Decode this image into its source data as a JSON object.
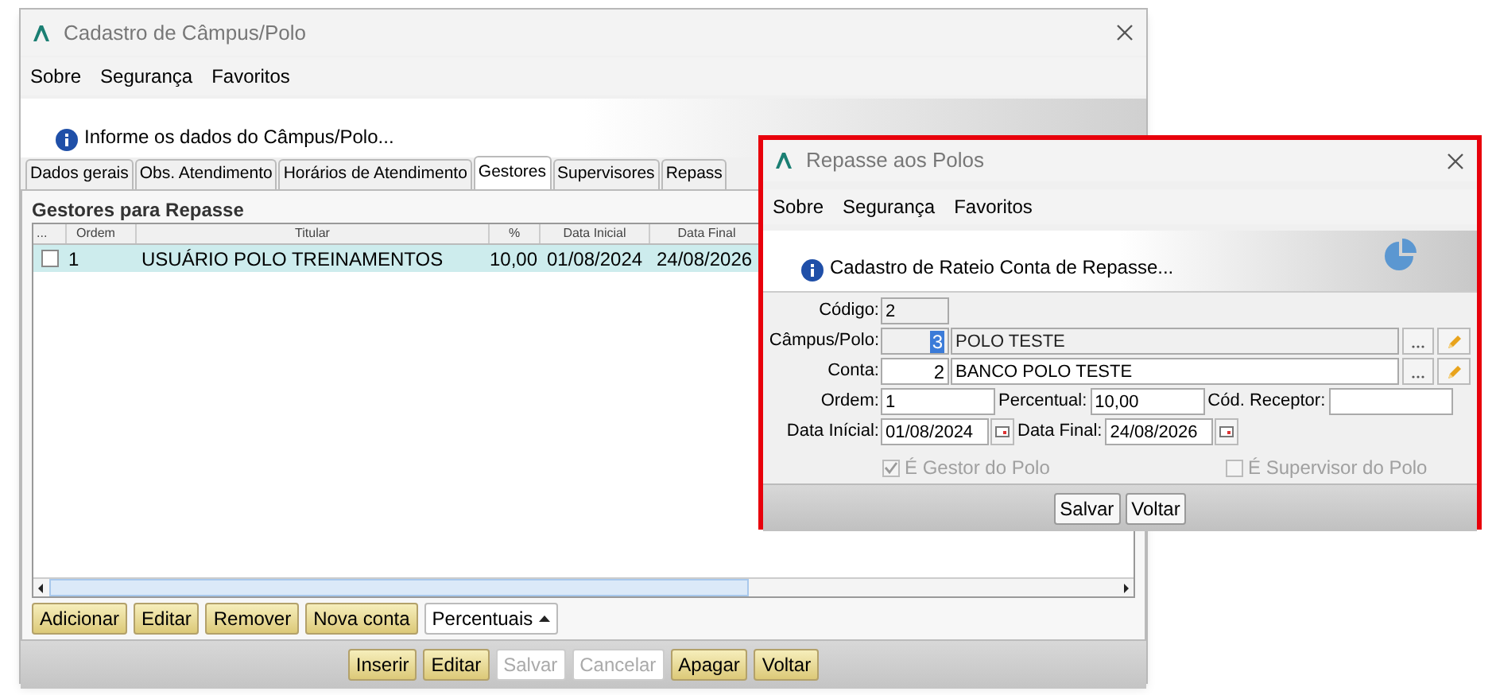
{
  "main_window": {
    "title": "Cadastro de Câmpus/Polo",
    "menu": [
      "Sobre",
      "Segurança",
      "Favoritos"
    ],
    "info": "Informe os dados do Câmpus/Polo...",
    "tabs": [
      {
        "label": "Dados gerais",
        "selected": false
      },
      {
        "label": "Obs. Atendimento",
        "selected": false
      },
      {
        "label": "Horários de Atendimento",
        "selected": false
      },
      {
        "label": "Gestores",
        "selected": true
      },
      {
        "label": "Supervisores",
        "selected": false
      },
      {
        "label": "Repass",
        "selected": false
      }
    ],
    "group_title": "Gestores para Repasse",
    "grid": {
      "checkbox_column": "...",
      "columns": [
        "Ordem",
        "Titular",
        "%",
        "Data Inicial",
        "Data Final"
      ],
      "rows": [
        {
          "checked": false,
          "selected": true,
          "cells": [
            "1",
            "USUÁRIO POLO TREINAMENTOS",
            "10,00",
            "01/08/2024",
            "24/08/2026"
          ]
        }
      ]
    },
    "grid_buttons": [
      {
        "label": "Adicionar",
        "kind": "button"
      },
      {
        "label": "Editar",
        "kind": "button"
      },
      {
        "label": "Remover",
        "kind": "button"
      },
      {
        "label": "Nova conta",
        "kind": "button"
      },
      {
        "label": "Percentuais",
        "kind": "dropdown"
      }
    ],
    "footer_buttons": [
      {
        "label": "Inserir",
        "disabled": false
      },
      {
        "label": "Editar",
        "disabled": false
      },
      {
        "label": "Salvar",
        "disabled": true
      },
      {
        "label": "Cancelar",
        "disabled": true
      },
      {
        "label": "Apagar",
        "disabled": false
      },
      {
        "label": "Voltar",
        "disabled": false
      }
    ]
  },
  "dialog": {
    "title": "Repasse aos Polos",
    "highlighted": true,
    "menu": [
      "Sobre",
      "Segurança",
      "Favoritos"
    ],
    "info": "Cadastro de Rateio Conta de Repasse...",
    "codigo": {
      "label": "Código:",
      "value": "2"
    },
    "campus": {
      "label": "Câmpus/Polo:",
      "code": "3",
      "name": "POLO TESTE",
      "disabled": true
    },
    "conta": {
      "label": "Conta:",
      "code": "2",
      "name": "BANCO POLO TESTE",
      "disabled": false
    },
    "ordem": {
      "label": "Ordem:",
      "value": "1"
    },
    "percentual": {
      "label": "Percentual:",
      "value": "10,00"
    },
    "receptor": {
      "label": "Cód. Receptor:"
    },
    "data_inicial": {
      "label": "Data Inícial:",
      "value": "01/08/2024"
    },
    "data_final": {
      "label": "Data Final:",
      "value": "24/08/2026"
    },
    "checkboxes": [
      {
        "label": "É Gestor do Polo",
        "checked": true,
        "disabled": true
      },
      {
        "label": "É Supervisor do Polo",
        "checked": false,
        "disabled": true
      }
    ],
    "buttons": [
      "Salvar",
      "Voltar"
    ]
  }
}
